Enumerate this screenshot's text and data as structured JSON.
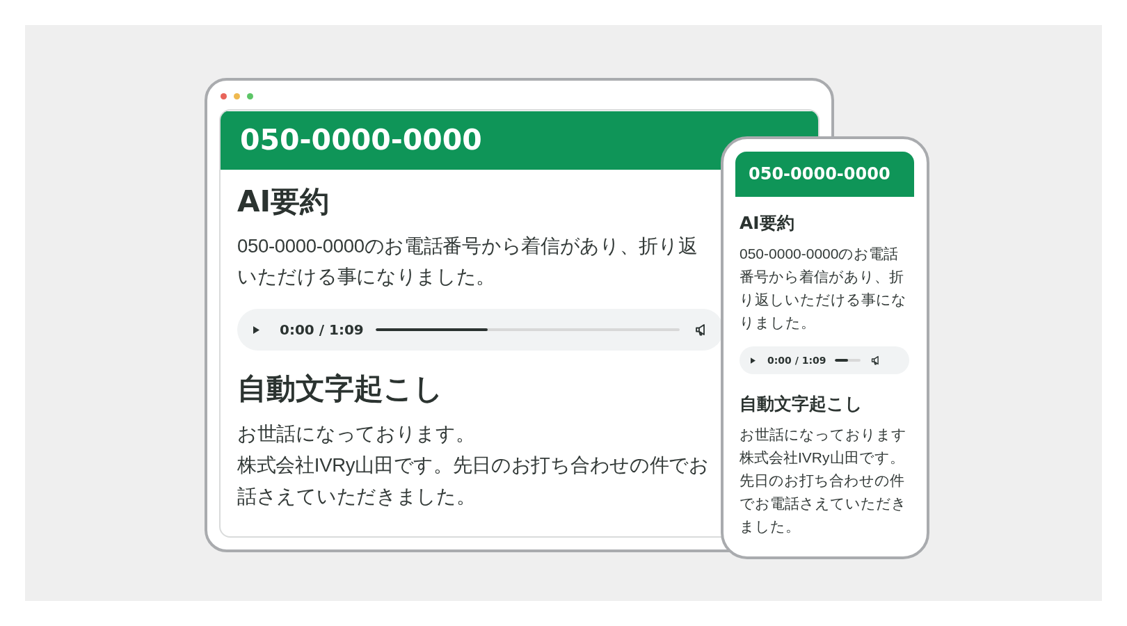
{
  "window": {
    "dots": [
      {
        "color": "#e8645a"
      },
      {
        "color": "#efb94f"
      },
      {
        "color": "#5cc567"
      }
    ]
  },
  "desktop": {
    "phone_number": "050-0000-0000",
    "summary": {
      "title": "AI要約",
      "lines": [
        "050-0000-0000のお電話番号から着信があり、折り返",
        "いただける事になりました。"
      ]
    },
    "player": {
      "time": "0:00 / 1:09",
      "level": 0.37
    },
    "transcript": {
      "title": "自動文字起こし",
      "lines": [
        "お世話になっております。",
        "株式会社IVRy山田です。先日のお打ち合わせの件でお",
        "話さえていただきました。"
      ]
    }
  },
  "mobile": {
    "phone_number": "050-0000-0000",
    "summary": {
      "title": "AI要約",
      "lines": [
        "050-0000-0000のお電話",
        "番号から着信があり、折",
        "り返しいただける事にな",
        "りました。"
      ]
    },
    "player": {
      "time": "0:00 / 1:09",
      "level": 0.52
    },
    "transcript": {
      "title": "自動文字起こし",
      "lines": [
        "お世話になっております",
        "株式会社IVRy山田です。",
        "先日のお打ち合わせの件",
        "でお電話さえていただき",
        "ました。"
      ]
    }
  }
}
